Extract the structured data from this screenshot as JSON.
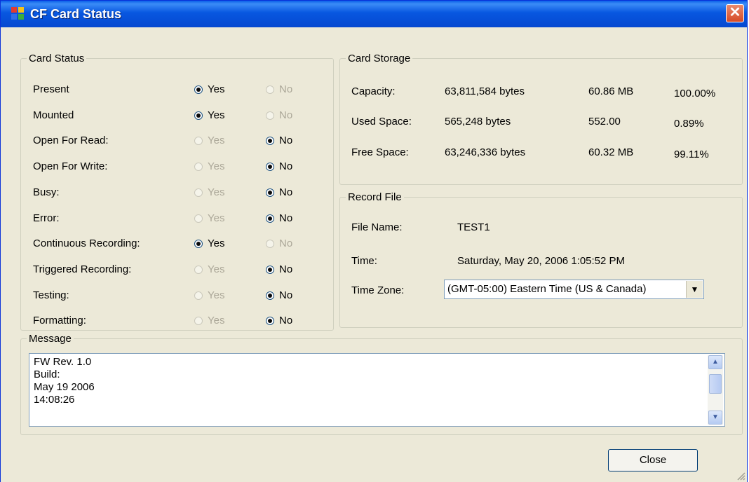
{
  "window": {
    "title": "CF Card Status",
    "close_glyph": "✕"
  },
  "card_status": {
    "legend": "Card Status",
    "yes_label": "Yes",
    "no_label": "No",
    "rows": [
      {
        "label": "Present",
        "value": "Yes"
      },
      {
        "label": "Mounted",
        "value": "Yes"
      },
      {
        "label": "Open For Read:",
        "value": "No"
      },
      {
        "label": "Open For Write:",
        "value": "No"
      },
      {
        "label": "Busy:",
        "value": "No"
      },
      {
        "label": "Error:",
        "value": "No"
      },
      {
        "label": "Continuous Recording:",
        "value": "Yes"
      },
      {
        "label": "Triggered Recording:",
        "value": "No"
      },
      {
        "label": "Testing:",
        "value": "No"
      },
      {
        "label": "Formatting:",
        "value": "No"
      }
    ]
  },
  "card_storage": {
    "legend": "Card Storage",
    "rows": [
      {
        "label": "Capacity:",
        "bytes": "63,811,584 bytes",
        "mb": "60.86 MB",
        "pct": "100.00%"
      },
      {
        "label": "Used Space:",
        "bytes": "565,248 bytes",
        "mb": "552.00",
        "pct": "0.89%"
      },
      {
        "label": "Free Space:",
        "bytes": "63,246,336 bytes",
        "mb": "60.32 MB",
        "pct": "99.11%"
      }
    ]
  },
  "record_file": {
    "legend": "Record File",
    "file_name_label": "File Name:",
    "file_name": "TEST1",
    "time_label": "Time:",
    "time": "Saturday, May 20, 2006 1:05:52 PM",
    "time_zone_label": "Time Zone:",
    "time_zone": "(GMT-05:00) Eastern Time (US & Canada)"
  },
  "message": {
    "legend": "Message",
    "text": "FW Rev. 1.0\nBuild:\nMay 19 2006\n14:08:26"
  },
  "close_button_label": "Close"
}
